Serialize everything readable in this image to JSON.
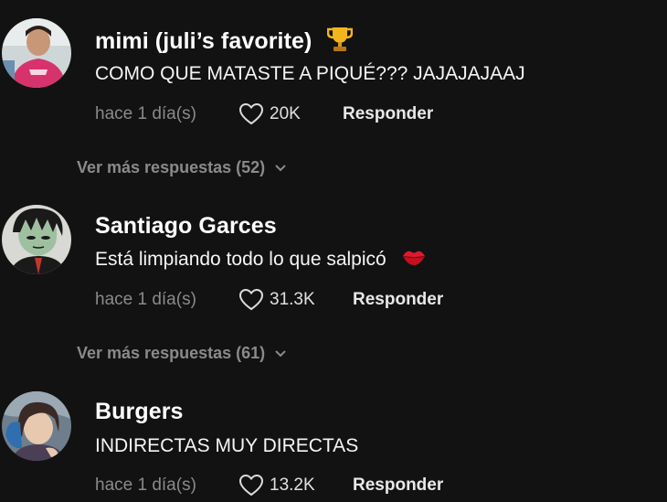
{
  "comments": [
    {
      "username": "mimi (juli’s favorite)",
      "username_emoji": "trophy-icon",
      "text": "COMO QUE MATASTE A PIQUÉ??? JAJAJAJAAJ",
      "timestamp": "hace 1 día(s)",
      "likes": "20K",
      "reply_label": "Responder",
      "more_replies": "Ver más respuestas (52)"
    },
    {
      "username": "Santiago Garces",
      "text": "Está limpiando todo lo que salpicó",
      "text_emoji": "lips-icon",
      "timestamp": "hace 1 día(s)",
      "likes": "31.3K",
      "reply_label": "Responder",
      "more_replies": "Ver más respuestas (61)"
    },
    {
      "username": "Burgers",
      "text": "INDIRECTAS MUY DIRECTAS",
      "timestamp": "hace 1 día(s)",
      "likes": "13.2K",
      "reply_label": "Responder"
    }
  ],
  "colors": {
    "background": "#121212",
    "primary_text": "#ffffff",
    "secondary_text": "#8a8a8a"
  }
}
